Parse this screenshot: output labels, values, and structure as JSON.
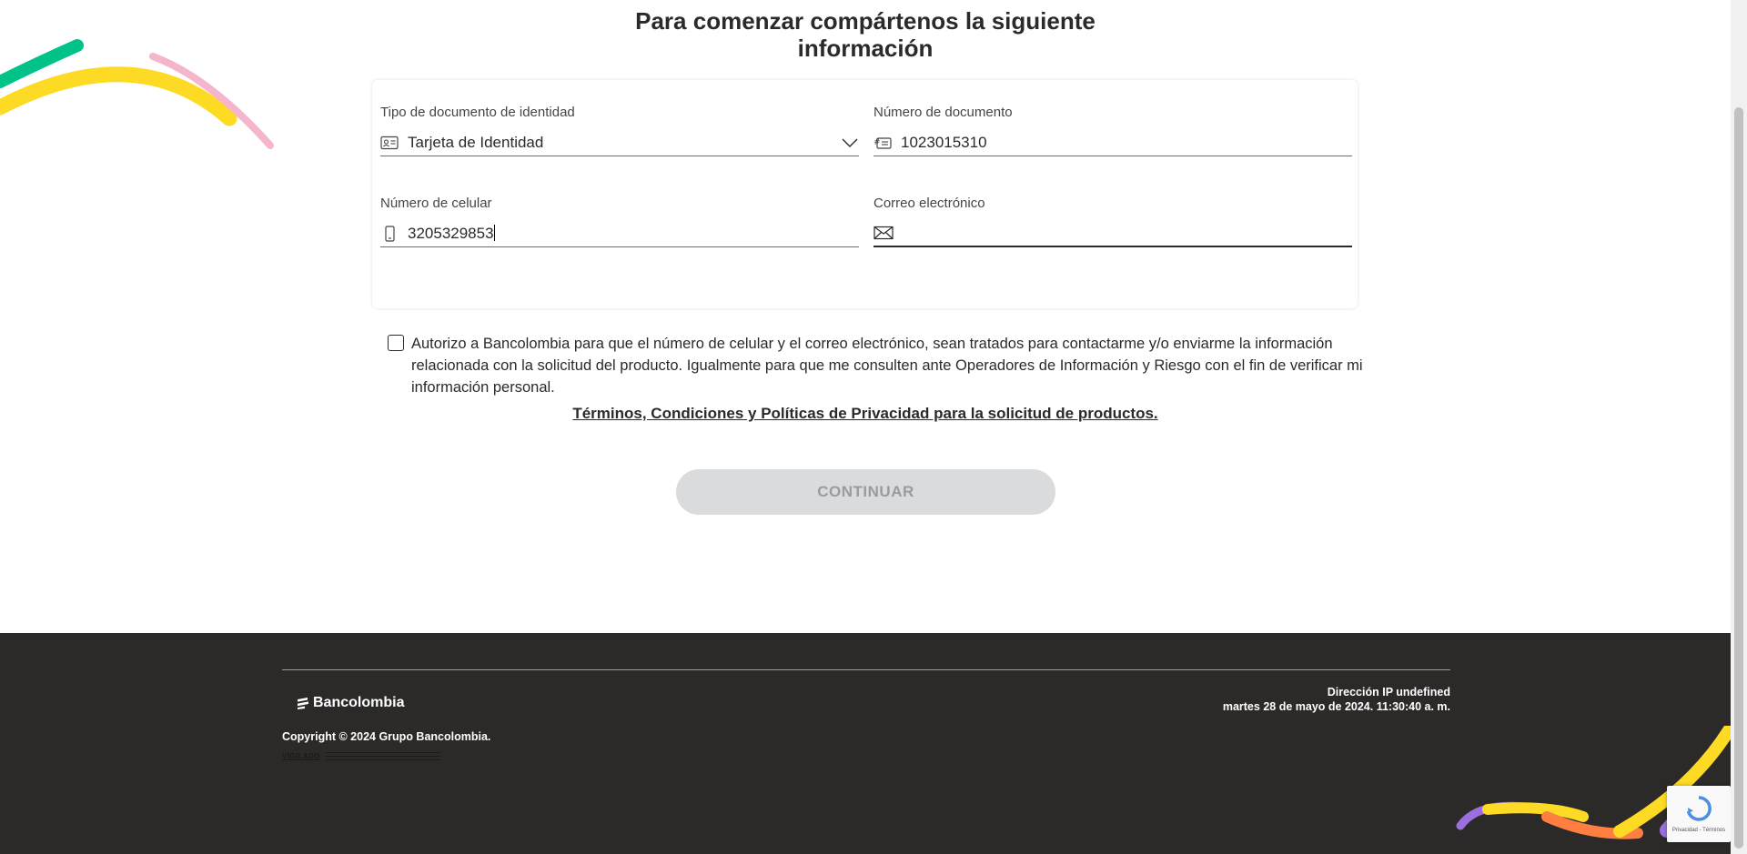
{
  "page": {
    "title_line1": "Para comenzar compártenos la siguiente",
    "title_line2": "información"
  },
  "form": {
    "doc_type": {
      "label": "Tipo de documento de identidad",
      "value": "Tarjeta de Identidad",
      "icon": "id-card-icon"
    },
    "doc_number": {
      "label": "Número de documento",
      "value": "1023015310",
      "icon": "document-number-icon"
    },
    "phone": {
      "label": "Número de celular",
      "value": "3205329853",
      "icon": "mobile-phone-icon"
    },
    "email": {
      "label": "Correo electrónico",
      "value": "",
      "icon": "envelope-icon"
    }
  },
  "consent": {
    "checked": false,
    "text": "Autorizo a Bancolombia para que el número de celular y el correo electrónico, sean tratados para contactarme y/o enviarme la información relacionada con la solicitud del producto. Igualmente para que me consulten ante Operadores de Información y Riesgo con el fin de verificar mi información personal.",
    "terms_link": "Términos, Condiciones y Políticas de Privacidad para la solicitud de productos."
  },
  "actions": {
    "continue_label": "CONTINUAR",
    "continue_enabled": false
  },
  "footer": {
    "brand": "Bancolombia",
    "copyright": "Copyright © 2024 Grupo Bancolombia.",
    "vigilado": "VIGILADO",
    "ip_line": "Dirección IP undefined",
    "datetime_line": "martes 28 de mayo de 2024. 11:30:40 a. m."
  },
  "recaptcha": {
    "text": "Privacidad - Términos"
  },
  "colors": {
    "text": "#2c2a29",
    "footer_bg": "#2c2a29",
    "button_disabled_bg": "#dadbdd",
    "button_disabled_text": "#9b9b9b",
    "deco_green": "#00c389",
    "deco_yellow": "#fdda24",
    "deco_pink": "#f5b6cd",
    "deco_purple": "#9c6fe0",
    "deco_orange": "#ff7f41"
  }
}
